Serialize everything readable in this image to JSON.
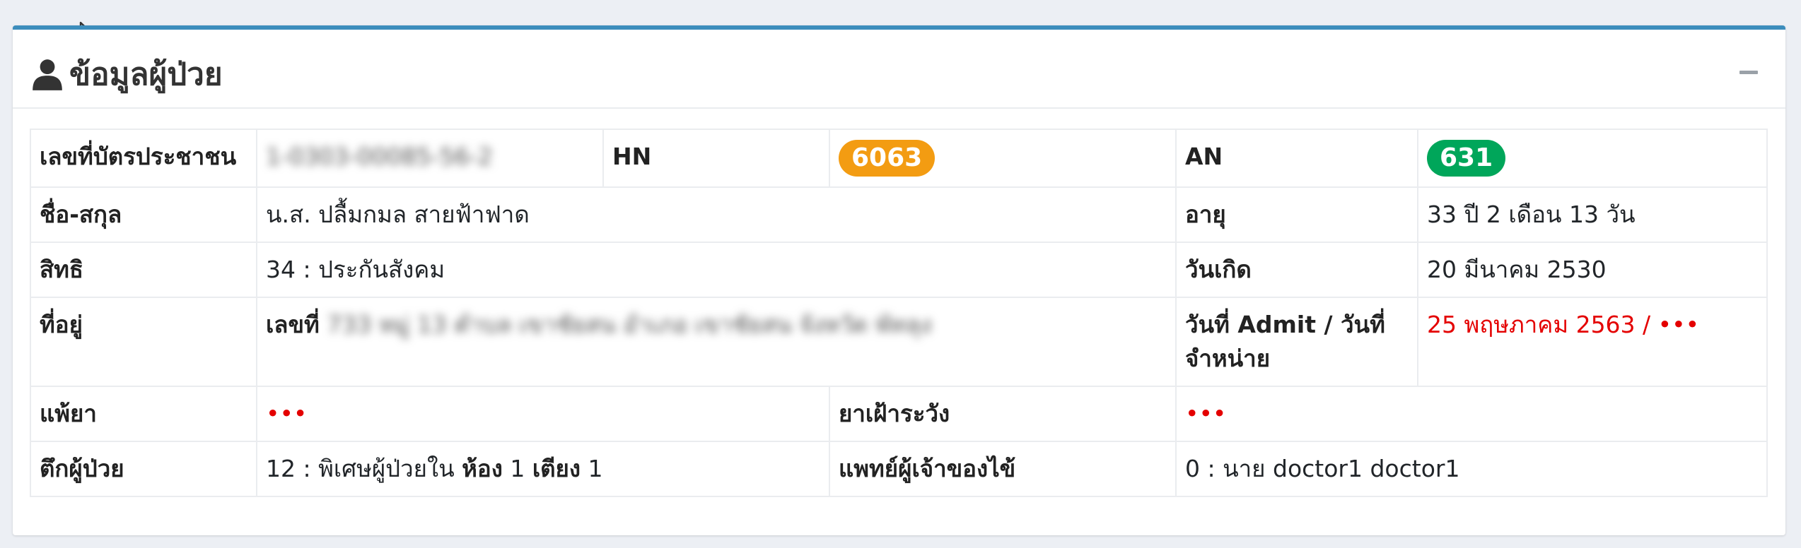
{
  "card": {
    "title": "ข้อมูลผู้ป่วย",
    "collapse_icon": "minus-icon",
    "title_icon": "user-icon"
  },
  "row1": {
    "id_label": "เลขที่บัตรประชาชน",
    "id_value": "1-0303-00085-56-2",
    "hn_label": "HN",
    "hn_value": "6063",
    "an_label": "AN",
    "an_value": "631"
  },
  "row2": {
    "name_label": "ชื่อ-สกุล",
    "name_value": "น.ส. ปลื้มกมล สายฟ้าฟาด",
    "age_label": "อายุ",
    "age_value": "33 ปี 2 เดือน 13 วัน"
  },
  "row3": {
    "right_label": "สิทธิ",
    "right_value": "34 : ประกันสังคม",
    "dob_label": "วันเกิด",
    "dob_value": "20 มีนาคม 2530"
  },
  "row4": {
    "addr_label": "ที่อยู่",
    "addr_prefix": "เลขที่",
    "addr_value": "733 หมู่ 13 ตำบล เขาชัยสน อำเภอ เขาชัยสน จังหวัด พัทลุง",
    "admit_label": "วันที่ Admit / วันที่จำหน่าย",
    "admit_value": "25 พฤษภาคม 2563 / •••"
  },
  "row5": {
    "allergy_label": "แพ้ยา",
    "allergy_value": "•••",
    "watch_label": "ยาเฝ้าระวัง",
    "watch_value": "•••"
  },
  "row6": {
    "ward_label": "ตึกผู้ป่วย",
    "ward_value": "12 : พิเศษผู้ป่วยใน",
    "room_label": "ห้อง",
    "room_value": "1",
    "bed_label": "เตียง",
    "bed_value": "1",
    "doctor_label": "แพทย์ผู้เจ้าของไข้",
    "doctor_value": "0 : นาย doctor1 doctor1"
  },
  "colors": {
    "accent": "#3c8dbc",
    "hn_badge": "#f39c12",
    "an_badge": "#00a65a",
    "alert_text": "#e40000"
  }
}
